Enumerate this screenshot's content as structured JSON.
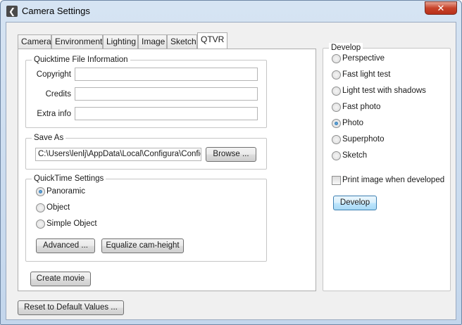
{
  "window": {
    "title": "Camera Settings",
    "close_label": "✕",
    "app_icon": "back-arrow-icon"
  },
  "tabs": [
    "Camera",
    "Environment",
    "Lighting",
    "Image",
    "Sketch",
    "QTVR"
  ],
  "active_tab": "QTVR",
  "qtvr": {
    "file_info": {
      "legend": "Quicktime File Information",
      "copyright_label": "Copyright",
      "copyright_value": "",
      "credits_label": "Credits",
      "credits_value": "",
      "extra_label": "Extra info",
      "extra_value": ""
    },
    "save_as": {
      "legend": "Save As",
      "path": "C:\\Users\\lenlj\\AppData\\Local\\Configura\\Configu",
      "browse_label": "Browse ..."
    },
    "quicktime_settings": {
      "legend": "QuickTime Settings",
      "options": [
        "Panoramic",
        "Object",
        "Simple Object"
      ],
      "selected": "Panoramic",
      "advanced_label": "Advanced ...",
      "equalize_label": "Equalize cam-height"
    },
    "create_movie_label": "Create movie"
  },
  "develop": {
    "legend": "Develop",
    "options": [
      "Perspective",
      "Fast light test",
      "Light test with shadows",
      "Fast photo",
      "Photo",
      "Superphoto",
      "Sketch"
    ],
    "selected": "Photo",
    "print_label": "Print image when developed",
    "print_checked": false,
    "develop_label": "Develop"
  },
  "reset_label": "Reset to Default Values ..."
}
